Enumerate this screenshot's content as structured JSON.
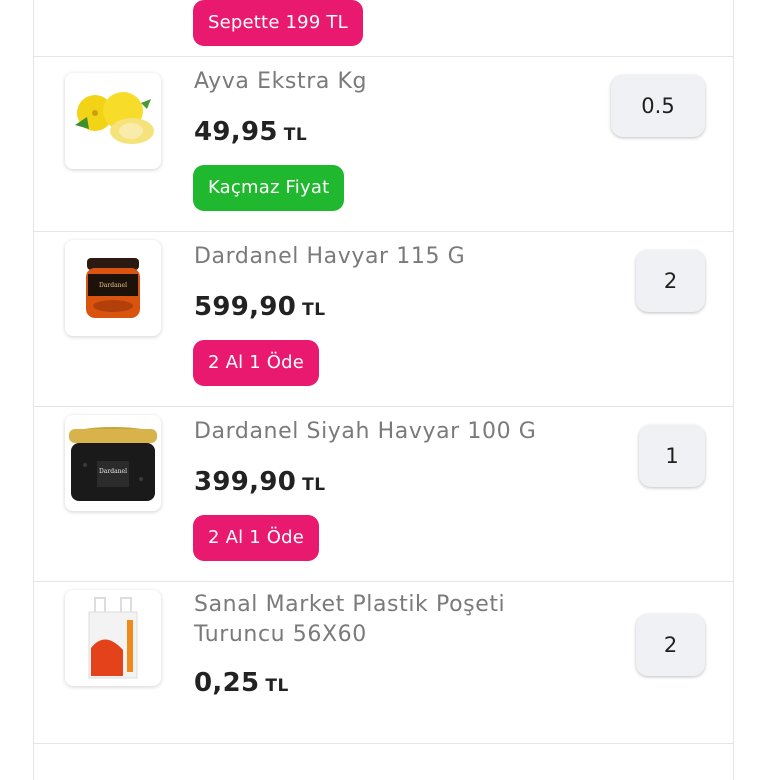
{
  "top_badge": "Sepette 199 TL",
  "products": [
    {
      "name": "Ayva Ekstra Kg",
      "price": "49,95",
      "currency": "TL",
      "badge": "Kaçmaz Fiyat",
      "badge_color": "#1fb82e",
      "quantity": "0.5",
      "image_icon": "quince-fruit-icon"
    },
    {
      "name": "Dardanel Havyar 115 G",
      "price": "599,90",
      "currency": "TL",
      "badge": "2 Al 1 Öde",
      "badge_color": "#e9196f",
      "quantity": "2",
      "image_icon": "red-caviar-jar-icon"
    },
    {
      "name": "Dardanel Siyah Havyar 100 G",
      "price": "399,90",
      "currency": "TL",
      "badge": "2 Al 1 Öde",
      "badge_color": "#e9196f",
      "quantity": "1",
      "image_icon": "black-caviar-jar-icon"
    },
    {
      "name_line1": "Sanal Market Plastik Poşeti",
      "name_line2": "Turuncu 56X60",
      "price": "0,25",
      "currency": "TL",
      "quantity": "2",
      "image_icon": "plastic-bag-icon"
    }
  ],
  "colors": {
    "promo_pink": "#e9196f",
    "promo_green": "#1fb82e",
    "quantity_bg": "#f0f1f4"
  }
}
